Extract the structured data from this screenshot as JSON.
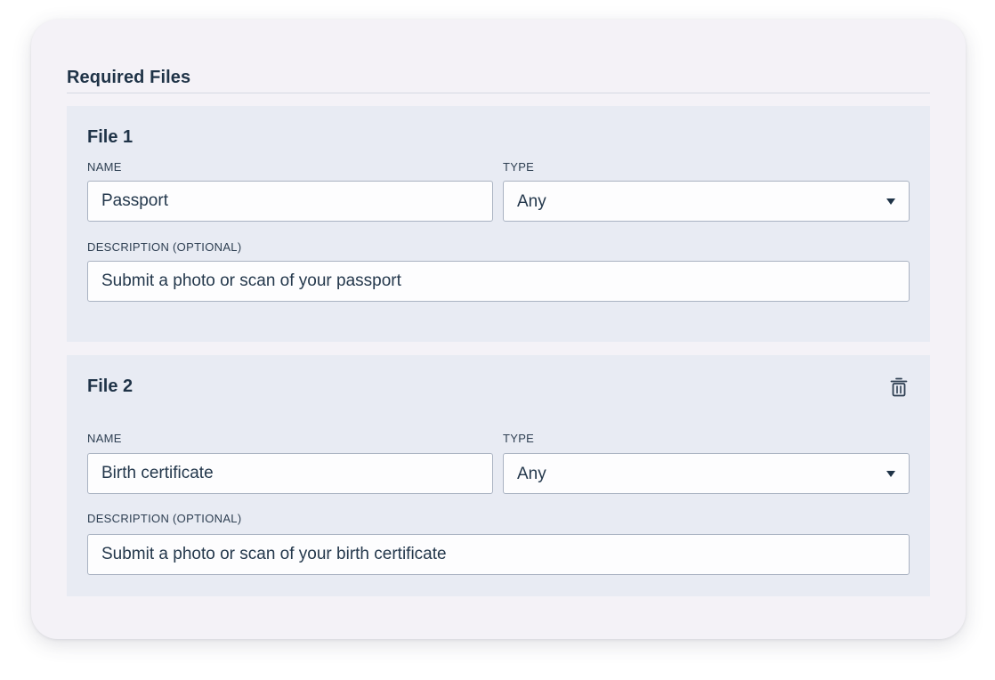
{
  "section": {
    "title": "Required Files"
  },
  "files": [
    {
      "title": "File 1",
      "name_label": "NAME",
      "name_value": "Passport",
      "type_label": "TYPE",
      "type_value": "Any",
      "description_label": "DESCRIPTION (OPTIONAL)",
      "description_value": "Submit a photo or scan of your passport",
      "deletable": false
    },
    {
      "title": "File 2",
      "name_label": "NAME",
      "name_value": "Birth certificate",
      "type_label": "TYPE",
      "type_value": "Any",
      "description_label": "DESCRIPTION (OPTIONAL)",
      "description_value": "Submit a photo or scan of your birth certificate",
      "deletable": true,
      "delete_icon": "trash-icon"
    }
  ],
  "colors": {
    "card_background": "#f4f2f7",
    "block_background": "#e8ebf3",
    "text_dark": "#1f3347",
    "input_border": "#aab3c2"
  }
}
